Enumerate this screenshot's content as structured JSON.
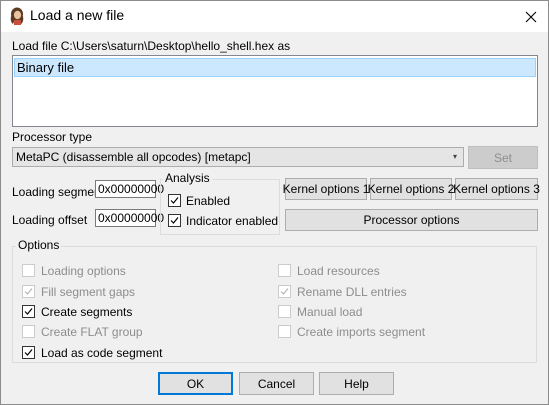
{
  "window": {
    "title": "Load a new file"
  },
  "file": {
    "label": "Load file C:\\Users\\saturn\\Desktop\\hello_shell.hex as",
    "formats": [
      "Binary file"
    ]
  },
  "processor": {
    "label": "Processor type",
    "selected": "MetaPC (disassemble all opcodes) [metapc]",
    "set_label": "Set"
  },
  "loading": {
    "segment_label": "Loading segment",
    "segment_value": "0x00000000",
    "offset_label": "Loading offset",
    "offset_value": "0x00000000"
  },
  "analysis": {
    "title": "Analysis",
    "enabled_label": "Enabled",
    "enabled": true,
    "indicator_label": "Indicator enabled",
    "indicator": true
  },
  "kernel": {
    "opt1": "Kernel options 1",
    "opt2": "Kernel options 2",
    "opt3": "Kernel options 3",
    "processor_options": "Processor options"
  },
  "options": {
    "title": "Options",
    "left": [
      {
        "label": "Loading options",
        "checked": false,
        "disabled": true
      },
      {
        "label": "Fill segment gaps",
        "checked": true,
        "disabled": true
      },
      {
        "label": "Create segments",
        "checked": true,
        "disabled": false
      },
      {
        "label": "Create FLAT group",
        "checked": false,
        "disabled": true
      },
      {
        "label": "Load as code segment",
        "checked": true,
        "disabled": false
      }
    ],
    "right": [
      {
        "label": "Load resources",
        "checked": false,
        "disabled": true
      },
      {
        "label": "Rename DLL entries",
        "checked": true,
        "disabled": true
      },
      {
        "label": "Manual load",
        "checked": false,
        "disabled": false
      },
      {
        "label": "Create imports segment",
        "checked": false,
        "disabled": true
      }
    ]
  },
  "buttons": {
    "ok": "OK",
    "cancel": "Cancel",
    "help": "Help"
  },
  "colors": {
    "selection": "#cce8ff",
    "default_button_border": "#0078d7"
  }
}
